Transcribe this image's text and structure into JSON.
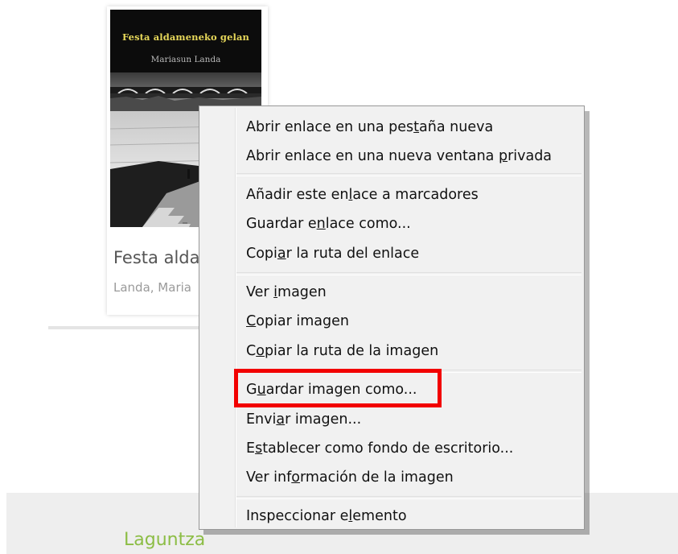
{
  "book": {
    "cover_title": "Festa aldameneko gelan",
    "cover_author": "Mariasun Landa",
    "title": "Festa alda",
    "author": "Landa, Maria"
  },
  "footer": {
    "link": "Laguntza"
  },
  "context_menu": {
    "items": [
      {
        "pre": "Abrir enlace en una pes",
        "key": "t",
        "post": "aña nueva"
      },
      {
        "pre": "Abrir enlace en una nueva ventana ",
        "key": "p",
        "post": "rivada"
      },
      {
        "pre": "Añadir este en",
        "key": "l",
        "post": "ace a marcadores"
      },
      {
        "pre": "Guardar e",
        "key": "n",
        "post": "lace como..."
      },
      {
        "pre": "Copi",
        "key": "a",
        "post": "r la ruta del enlace"
      },
      {
        "pre": "Ver ",
        "key": "i",
        "post": "magen"
      },
      {
        "pre": "",
        "key": "C",
        "post": "opiar imagen"
      },
      {
        "pre": "C",
        "key": "o",
        "post": "piar la ruta de la imagen"
      },
      {
        "pre": "G",
        "key": "u",
        "post": "ardar imagen como..."
      },
      {
        "pre": "Envi",
        "key": "a",
        "post": "r imagen..."
      },
      {
        "pre": "E",
        "key": "s",
        "post": "tablecer como fondo de escritorio..."
      },
      {
        "pre": "Ver inf",
        "key": "o",
        "post": "rmación de la imagen"
      },
      {
        "pre": "Inspeccionar e",
        "key": "l",
        "post": "emento"
      }
    ]
  },
  "colors": {
    "highlight": "#f20000",
    "footer_link": "#8cbd45",
    "cover_title": "#e7d85a"
  }
}
